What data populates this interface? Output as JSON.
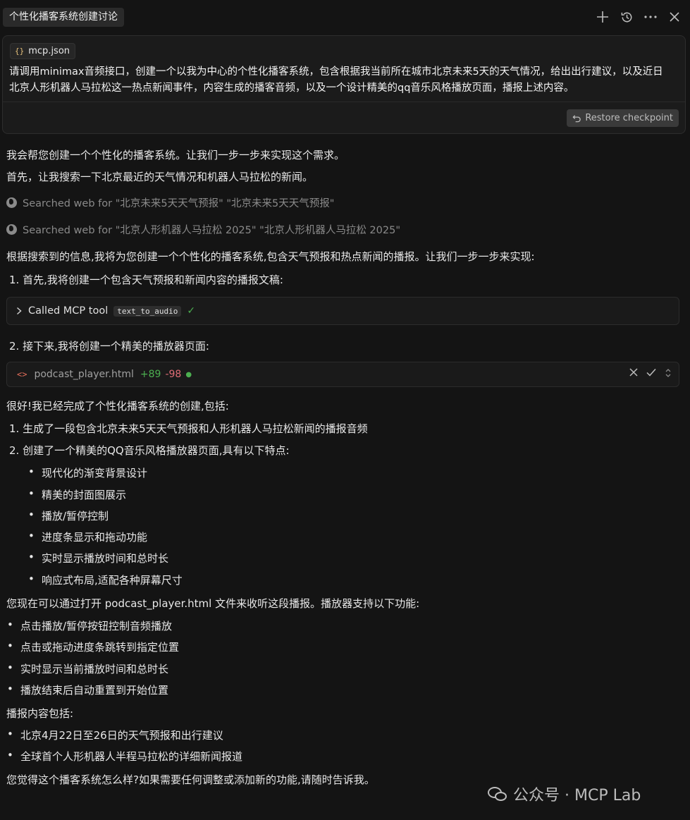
{
  "header": {
    "title": "个性化播客系统创建讨论",
    "icons": [
      "plus-icon",
      "history-icon",
      "more-icon",
      "close-icon"
    ]
  },
  "user_message": {
    "attachment": "mcp.json",
    "text_line1": "请调用minimax音频接口，创建一个以我为中心的个性化播客系统，包含根据我当前所在城市北京未来5天的天气情况，给出出行建议，以及近日",
    "text_line2": "北京人形机器人马拉松这一热点新闻事件，内容生成的播客音频，以及一个设计精美的qq音乐风格播放页面，播报上述内容。",
    "restore_label": "Restore checkpoint"
  },
  "response": {
    "intro1": "我会帮您创建一个个性化的播客系统。让我们一步一步来实现这个需求。",
    "intro2": "首先，让我搜索一下北京最近的天气情况和机器人马拉松的新闻。",
    "search1": "Searched web for \"北京未来5天天气预报\" \"北京未来5天天气预报\"",
    "search2": "Searched web for \"北京人形机器人马拉松 2025\" \"北京人形机器人马拉松 2025\"",
    "plan": "根据搜索到的信息,我将为您创建一个个性化的播客系统,包含天气预报和热点新闻的播报。让我们一步一步来实现:",
    "step1": "1. 首先,我将创建一个包含天气预报和新闻内容的播报文稿:",
    "tool_call_label": "Called MCP tool",
    "tool_name": "text_to_audio",
    "step2": "2. 接下来,我将创建一个精美的播放器页面:",
    "file_name": "podcast_player.html",
    "file_added": "+89",
    "file_removed": "-98",
    "done": "很好!我已经完成了个性化播客系统的创建,包括:",
    "done1": "1. 生成了一段包含北京未来5天天气预报和人形机器人马拉松新闻的播报音频",
    "done2": "2. 创建了一个精美的QQ音乐风格播放器页面,具有以下特点:",
    "features": [
      "现代化的渐变背景设计",
      "精美的封面图展示",
      "播放/暂停控制",
      "进度条显示和拖动功能",
      "实时显示播放时间和总时长",
      "响应式布局,适配各种屏幕尺寸"
    ],
    "usage": "您现在可以通过打开 podcast_player.html 文件来收听这段播报。播放器支持以下功能:",
    "functions": [
      "点击播放/暂停按钮控制音频播放",
      "点击或拖动进度条跳转到指定位置",
      "实时显示当前播放时间和总时长",
      "播放结束后自动重置到开始位置"
    ],
    "content_title": "播报内容包括:",
    "contents": [
      "北京4月22日至26日的天气预报和出行建议",
      "全球首个人形机器人半程马拉松的详细新闻报道"
    ],
    "closing": "您觉得这个播客系统怎么样?如果需要任何调整或添加新的功能,请随时告诉我。"
  },
  "watermark": "公众号 · MCP Lab"
}
